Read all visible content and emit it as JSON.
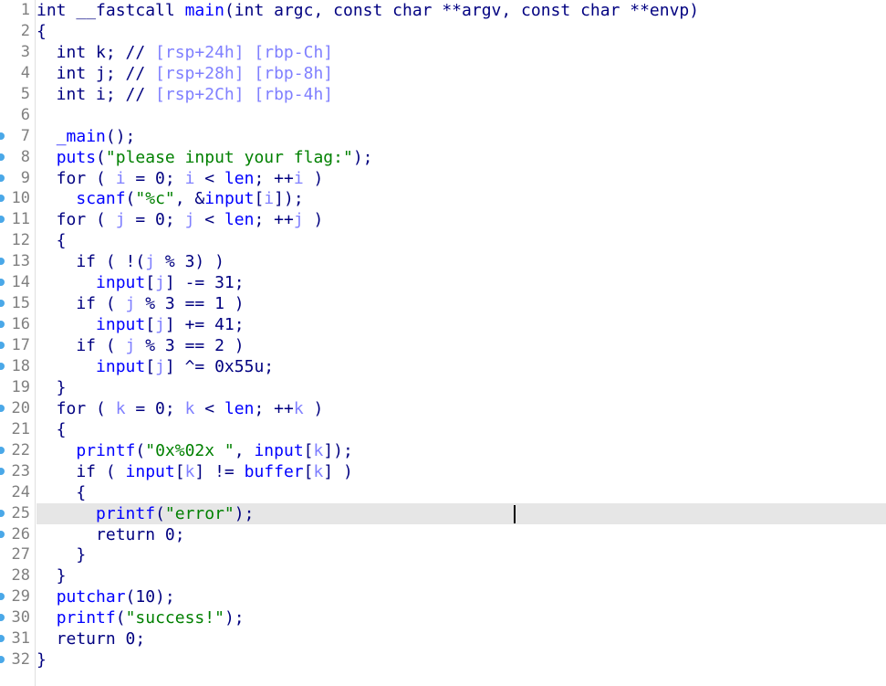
{
  "editor": {
    "highlighted_line": 25,
    "colors": {
      "keyword": "#000080",
      "identifier": "#0000ff",
      "local_var": "#8080ff",
      "string": "#008000",
      "line_number": "#808080",
      "highlight": "#e6e6e6",
      "breakpoint_dot": "#4aa8e8"
    },
    "lines": [
      {
        "n": "1",
        "dot": false,
        "tokens": [
          [
            "int ",
            "k"
          ],
          [
            "__fastcall ",
            "k"
          ],
          [
            "main",
            "f"
          ],
          [
            "(int argc, const char **argv, const char **envp)",
            "k"
          ]
        ]
      },
      {
        "n": "2",
        "dot": false,
        "tokens": [
          [
            "{",
            "k"
          ]
        ]
      },
      {
        "n": "3",
        "dot": false,
        "tokens": [
          [
            "  int k; // ",
            "k"
          ],
          [
            "[rsp+24h] [rbp-Ch]",
            "c"
          ]
        ]
      },
      {
        "n": "4",
        "dot": false,
        "tokens": [
          [
            "  int j; // ",
            "k"
          ],
          [
            "[rsp+28h] [rbp-8h]",
            "c"
          ]
        ]
      },
      {
        "n": "5",
        "dot": false,
        "tokens": [
          [
            "  int i; // ",
            "k"
          ],
          [
            "[rsp+2Ch] [rbp-4h]",
            "c"
          ]
        ]
      },
      {
        "n": "6",
        "dot": false,
        "tokens": []
      },
      {
        "n": "7",
        "dot": true,
        "tokens": [
          [
            "  ",
            "k"
          ],
          [
            "_main",
            "f"
          ],
          [
            "();",
            "k"
          ]
        ]
      },
      {
        "n": "8",
        "dot": true,
        "tokens": [
          [
            "  ",
            "k"
          ],
          [
            "puts",
            "f"
          ],
          [
            "(",
            "k"
          ],
          [
            "\"please input your flag:\"",
            "s"
          ],
          [
            ");",
            "k"
          ]
        ]
      },
      {
        "n": "9",
        "dot": true,
        "tokens": [
          [
            "  for ( ",
            "k"
          ],
          [
            "i",
            "v"
          ],
          [
            " = 0; ",
            "k"
          ],
          [
            "i",
            "v"
          ],
          [
            " < ",
            "k"
          ],
          [
            "len",
            "f"
          ],
          [
            "; ++",
            "k"
          ],
          [
            "i",
            "v"
          ],
          [
            " )",
            "k"
          ]
        ]
      },
      {
        "n": "10",
        "dot": true,
        "tokens": [
          [
            "    ",
            "k"
          ],
          [
            "scanf",
            "f"
          ],
          [
            "(",
            "k"
          ],
          [
            "\"%c\"",
            "s"
          ],
          [
            ", &",
            "k"
          ],
          [
            "input",
            "f"
          ],
          [
            "[",
            "k"
          ],
          [
            "i",
            "v"
          ],
          [
            "]);",
            "k"
          ]
        ]
      },
      {
        "n": "11",
        "dot": true,
        "tokens": [
          [
            "  for ( ",
            "k"
          ],
          [
            "j",
            "v"
          ],
          [
            " = 0; ",
            "k"
          ],
          [
            "j",
            "v"
          ],
          [
            " < ",
            "k"
          ],
          [
            "len",
            "f"
          ],
          [
            "; ++",
            "k"
          ],
          [
            "j",
            "v"
          ],
          [
            " )",
            "k"
          ]
        ]
      },
      {
        "n": "12",
        "dot": false,
        "tokens": [
          [
            "  {",
            "k"
          ]
        ]
      },
      {
        "n": "13",
        "dot": true,
        "tokens": [
          [
            "    if ( !(",
            "k"
          ],
          [
            "j",
            "v"
          ],
          [
            " % 3) )",
            "k"
          ]
        ]
      },
      {
        "n": "14",
        "dot": true,
        "tokens": [
          [
            "      ",
            "k"
          ],
          [
            "input",
            "f"
          ],
          [
            "[",
            "k"
          ],
          [
            "j",
            "v"
          ],
          [
            "] -= 31;",
            "k"
          ]
        ]
      },
      {
        "n": "15",
        "dot": true,
        "tokens": [
          [
            "    if ( ",
            "k"
          ],
          [
            "j",
            "v"
          ],
          [
            " % 3 == 1 )",
            "k"
          ]
        ]
      },
      {
        "n": "16",
        "dot": true,
        "tokens": [
          [
            "      ",
            "k"
          ],
          [
            "input",
            "f"
          ],
          [
            "[",
            "k"
          ],
          [
            "j",
            "v"
          ],
          [
            "] += 41;",
            "k"
          ]
        ]
      },
      {
        "n": "17",
        "dot": true,
        "tokens": [
          [
            "    if ( ",
            "k"
          ],
          [
            "j",
            "v"
          ],
          [
            " % 3 == 2 )",
            "k"
          ]
        ]
      },
      {
        "n": "18",
        "dot": true,
        "tokens": [
          [
            "      ",
            "k"
          ],
          [
            "input",
            "f"
          ],
          [
            "[",
            "k"
          ],
          [
            "j",
            "v"
          ],
          [
            "] ^= 0x55u;",
            "k"
          ]
        ]
      },
      {
        "n": "19",
        "dot": false,
        "tokens": [
          [
            "  }",
            "k"
          ]
        ]
      },
      {
        "n": "20",
        "dot": true,
        "tokens": [
          [
            "  for ( ",
            "k"
          ],
          [
            "k",
            "v"
          ],
          [
            " = 0; ",
            "k"
          ],
          [
            "k",
            "v"
          ],
          [
            " < ",
            "k"
          ],
          [
            "len",
            "f"
          ],
          [
            "; ++",
            "k"
          ],
          [
            "k",
            "v"
          ],
          [
            " )",
            "k"
          ]
        ]
      },
      {
        "n": "21",
        "dot": false,
        "tokens": [
          [
            "  {",
            "k"
          ]
        ]
      },
      {
        "n": "22",
        "dot": true,
        "tokens": [
          [
            "    ",
            "k"
          ],
          [
            "printf",
            "f"
          ],
          [
            "(",
            "k"
          ],
          [
            "\"0x%02x \"",
            "s"
          ],
          [
            ", ",
            "k"
          ],
          [
            "input",
            "f"
          ],
          [
            "[",
            "k"
          ],
          [
            "k",
            "v"
          ],
          [
            "]);",
            "k"
          ]
        ]
      },
      {
        "n": "23",
        "dot": true,
        "tokens": [
          [
            "    if ( ",
            "k"
          ],
          [
            "input",
            "f"
          ],
          [
            "[",
            "k"
          ],
          [
            "k",
            "v"
          ],
          [
            "] != ",
            "k"
          ],
          [
            "buffer",
            "f"
          ],
          [
            "[",
            "k"
          ],
          [
            "k",
            "v"
          ],
          [
            "] )",
            "k"
          ]
        ]
      },
      {
        "n": "24",
        "dot": false,
        "tokens": [
          [
            "    {",
            "k"
          ]
        ]
      },
      {
        "n": "25",
        "dot": true,
        "tokens": [
          [
            "      ",
            "k"
          ],
          [
            "printf",
            "f"
          ],
          [
            "(",
            "k"
          ],
          [
            "\"error\"",
            "s"
          ],
          [
            ");",
            "k"
          ]
        ]
      },
      {
        "n": "26",
        "dot": true,
        "tokens": [
          [
            "      return 0;",
            "k"
          ]
        ]
      },
      {
        "n": "27",
        "dot": false,
        "tokens": [
          [
            "    }",
            "k"
          ]
        ]
      },
      {
        "n": "28",
        "dot": false,
        "tokens": [
          [
            "  }",
            "k"
          ]
        ]
      },
      {
        "n": "29",
        "dot": true,
        "tokens": [
          [
            "  ",
            "k"
          ],
          [
            "putchar",
            "f"
          ],
          [
            "(10);",
            "k"
          ]
        ]
      },
      {
        "n": "30",
        "dot": true,
        "tokens": [
          [
            "  ",
            "k"
          ],
          [
            "printf",
            "f"
          ],
          [
            "(",
            "k"
          ],
          [
            "\"success!\"",
            "s"
          ],
          [
            ");",
            "k"
          ]
        ]
      },
      {
        "n": "31",
        "dot": true,
        "tokens": [
          [
            "  return 0;",
            "k"
          ]
        ]
      },
      {
        "n": "32",
        "dot": true,
        "tokens": [
          [
            "}",
            "k"
          ]
        ]
      }
    ]
  }
}
